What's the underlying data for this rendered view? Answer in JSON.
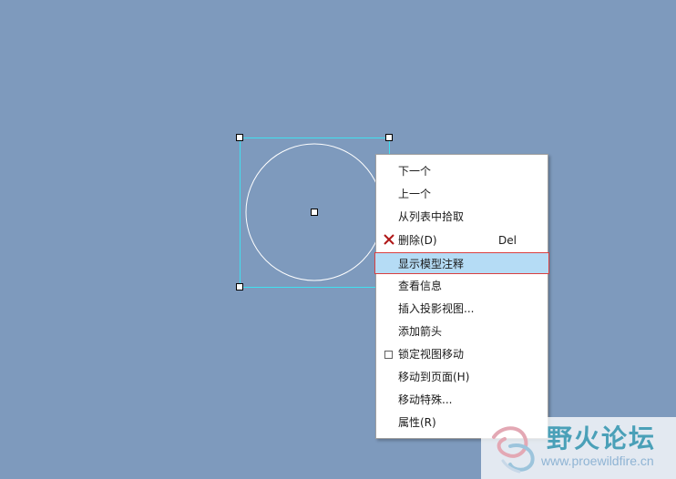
{
  "menu": {
    "items": [
      {
        "label": "下一个",
        "shortcut": "",
        "icon": "",
        "highlighted": false
      },
      {
        "label": "上一个",
        "shortcut": "",
        "icon": "",
        "highlighted": false
      },
      {
        "label": "从列表中拾取",
        "shortcut": "",
        "icon": "",
        "highlighted": false
      },
      {
        "label": "删除(D)",
        "shortcut": "Del",
        "icon": "delete-x-icon",
        "highlighted": false
      },
      {
        "label": "显示模型注释",
        "shortcut": "",
        "icon": "",
        "highlighted": true
      },
      {
        "label": "查看信息",
        "shortcut": "",
        "icon": "",
        "highlighted": false
      },
      {
        "label": "插入投影视图...",
        "shortcut": "",
        "icon": "",
        "highlighted": false
      },
      {
        "label": "添加箭头",
        "shortcut": "",
        "icon": "",
        "highlighted": false
      },
      {
        "label": "锁定视图移动",
        "shortcut": "",
        "icon": "checkbox-icon",
        "highlighted": false
      },
      {
        "label": "移动到页面(H)",
        "shortcut": "",
        "icon": "",
        "highlighted": false
      },
      {
        "label": "移动特殊...",
        "shortcut": "",
        "icon": "",
        "highlighted": false
      },
      {
        "label": "属性(R)",
        "shortcut": "",
        "icon": "",
        "highlighted": false
      }
    ]
  },
  "watermark": {
    "title": "野火论坛",
    "url": "www.proewildfire.cn"
  },
  "colors": {
    "background": "#7e9abd",
    "selection_box": "#40e0f0",
    "circle": "#ffffff",
    "highlight": "#b5dcf5",
    "highlight_border": "#d94040"
  }
}
